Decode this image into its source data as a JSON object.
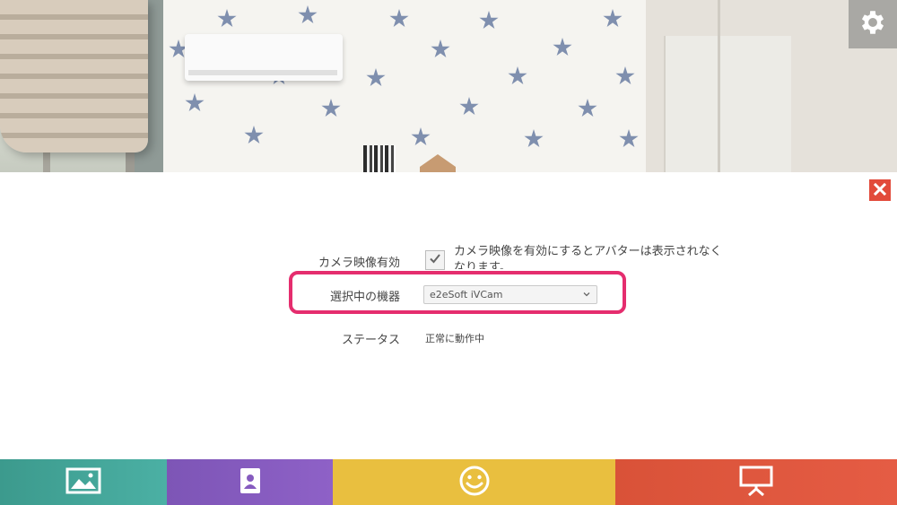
{
  "toolbar_top": {
    "settings_icon": "gear-icon"
  },
  "panel": {
    "close_icon": "close-icon",
    "camera_enable": {
      "label": "カメラ映像有効",
      "checked": true,
      "note": "カメラ映像を有効にするとアバターは表示されなくなります。"
    },
    "selected_device": {
      "label": "選択中の機器",
      "value": "e2eSoft iVCam"
    },
    "status": {
      "label": "ステータス",
      "value": "正常に動作中"
    },
    "highlight_color": "#e52d6e"
  },
  "bottom_toolbar": {
    "items": [
      {
        "icon": "image-icon",
        "color": "#45a89b"
      },
      {
        "icon": "contact-card-icon",
        "color": "#865bbf"
      },
      {
        "icon": "smiley-icon",
        "color": "#e9bf3f"
      },
      {
        "icon": "presentation-icon",
        "color": "#e05841"
      }
    ]
  }
}
